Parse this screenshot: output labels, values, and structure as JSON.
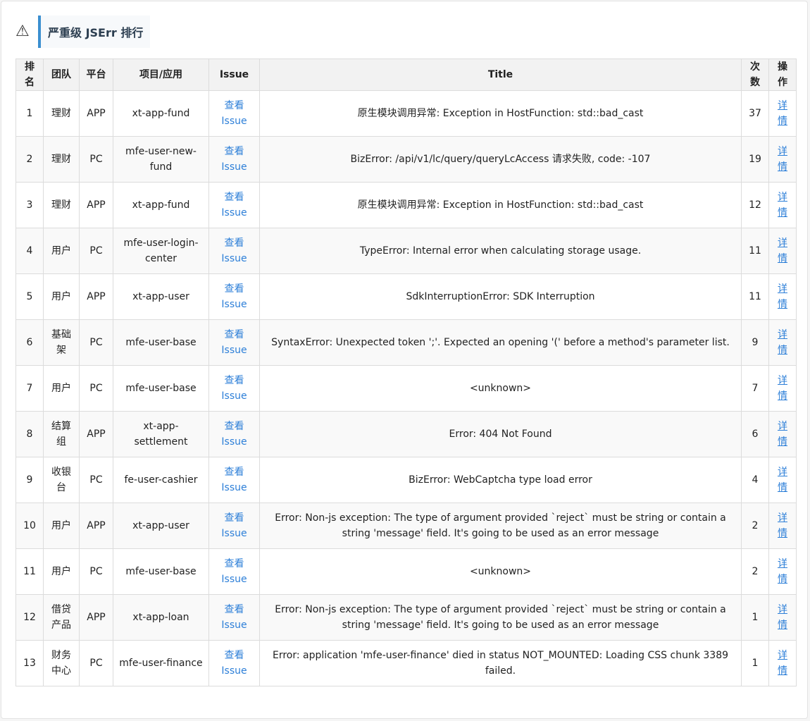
{
  "header": {
    "icon": "warning-icon",
    "title": "严重级 JSErr 排行"
  },
  "table": {
    "columns": [
      "排名",
      "团队",
      "平台",
      "项目/应用",
      "Issue",
      "Title",
      "次数",
      "操作"
    ],
    "issue_label": "查看\nIssue",
    "action_label": "详情",
    "rows": [
      {
        "rank": "1",
        "team": "理财",
        "platform": "APP",
        "project": "xt-app-fund",
        "title": "原生模块调用异常: Exception in HostFunction: std::bad_cast",
        "count": "37"
      },
      {
        "rank": "2",
        "team": "理财",
        "platform": "PC",
        "project": "mfe-user-new-fund",
        "title": "BizError: /api/v1/lc/query/queryLcAccess 请求失败, code: -107",
        "count": "19"
      },
      {
        "rank": "3",
        "team": "理财",
        "platform": "APP",
        "project": "xt-app-fund",
        "title": "原生模块调用异常: Exception in HostFunction: std::bad_cast",
        "count": "12"
      },
      {
        "rank": "4",
        "team": "用户",
        "platform": "PC",
        "project": "mfe-user-login-center",
        "title": "TypeError: Internal error when calculating storage usage.",
        "count": "11"
      },
      {
        "rank": "5",
        "team": "用户",
        "platform": "APP",
        "project": "xt-app-user",
        "title": "SdkInterruptionError: SDK Interruption",
        "count": "11"
      },
      {
        "rank": "6",
        "team": "基础架",
        "platform": "PC",
        "project": "mfe-user-base",
        "title": "SyntaxError: Unexpected token ';'. Expected an opening '(' before a method's parameter list.",
        "count": "9"
      },
      {
        "rank": "7",
        "team": "用户",
        "platform": "PC",
        "project": "mfe-user-base",
        "title": "<unknown>",
        "count": "7"
      },
      {
        "rank": "8",
        "team": "结算组",
        "platform": "APP",
        "project": "xt-app-settlement",
        "title": "Error: 404 Not Found",
        "count": "6"
      },
      {
        "rank": "9",
        "team": "收银台",
        "platform": "PC",
        "project": "fe-user-cashier",
        "title": "BizError: WebCaptcha type load error",
        "count": "4"
      },
      {
        "rank": "10",
        "team": "用户",
        "platform": "APP",
        "project": "xt-app-user",
        "title": "Error: Non-js exception: The type of argument provided `reject` must be string or contain a string 'message' field. It's going to be used as an error message",
        "count": "2"
      },
      {
        "rank": "11",
        "team": "用户",
        "platform": "PC",
        "project": "mfe-user-base",
        "title": "<unknown>",
        "count": "2"
      },
      {
        "rank": "12",
        "team": "借贷产品",
        "platform": "APP",
        "project": "xt-app-loan",
        "title": "Error: Non-js exception: The type of argument provided `reject` must be string or contain a string 'message' field. It's going to be used as an error message",
        "count": "1"
      },
      {
        "rank": "13",
        "team": "财务中心",
        "platform": "PC",
        "project": "mfe-user-finance",
        "title": "Error: application 'mfe-user-finance' died in status NOT_MOUNTED: Loading CSS chunk 3389 failed.",
        "count": "1"
      }
    ]
  }
}
